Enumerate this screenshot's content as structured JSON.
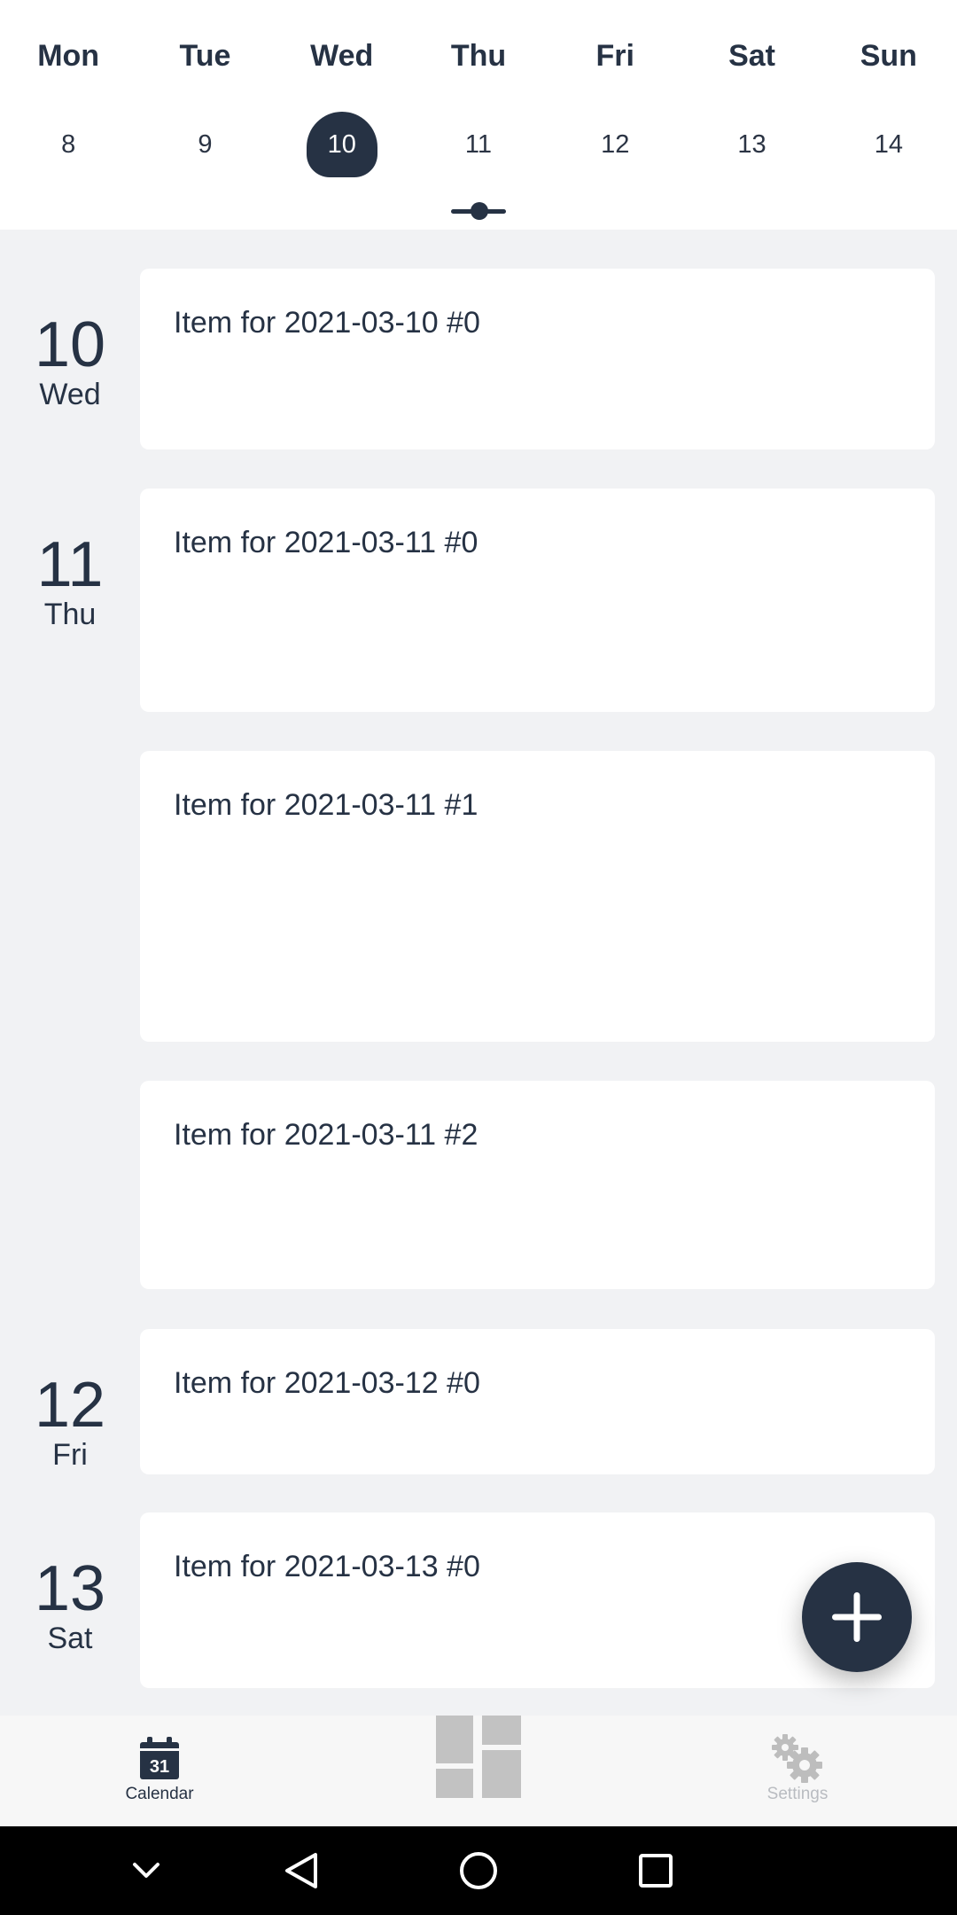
{
  "week": {
    "days": [
      {
        "dow": "Mon",
        "date": "8"
      },
      {
        "dow": "Tue",
        "date": "9"
      },
      {
        "dow": "Wed",
        "date": "10"
      },
      {
        "dow": "Thu",
        "date": "11"
      },
      {
        "dow": "Fri",
        "date": "12"
      },
      {
        "dow": "Sat",
        "date": "13"
      },
      {
        "dow": "Sun",
        "date": "14"
      }
    ],
    "selected_date": "10"
  },
  "agenda": {
    "days": [
      {
        "num": "10",
        "name": "Wed"
      },
      {
        "num": "11",
        "name": "Thu"
      },
      {
        "num": "12",
        "name": "Fri"
      },
      {
        "num": "13",
        "name": "Sat"
      }
    ],
    "items": [
      {
        "title": "Item for 2021-03-10 #0"
      },
      {
        "title": "Item for 2021-03-11 #0"
      },
      {
        "title": "Item for 2021-03-11 #1"
      },
      {
        "title": "Item for 2021-03-11 #2"
      },
      {
        "title": "Item for 2021-03-12 #0"
      },
      {
        "title": "Item for 2021-03-13 #0"
      }
    ]
  },
  "fab": {
    "icon": "plus-icon"
  },
  "bottom_nav": {
    "calendar": {
      "label": "Calendar",
      "icon": "calendar-icon",
      "icon_text": "31"
    },
    "dashboard": {
      "icon": "dashboard-icon"
    },
    "settings": {
      "label": "Settings",
      "icon": "gears-icon"
    }
  },
  "system_nav": {
    "buttons": [
      "chevron-down-icon",
      "back-icon",
      "home-icon",
      "recents-icon"
    ]
  },
  "colors": {
    "primary": "#263244",
    "background": "#f1f2f4",
    "card": "#ffffff",
    "inactive": "#bdbdbd"
  }
}
